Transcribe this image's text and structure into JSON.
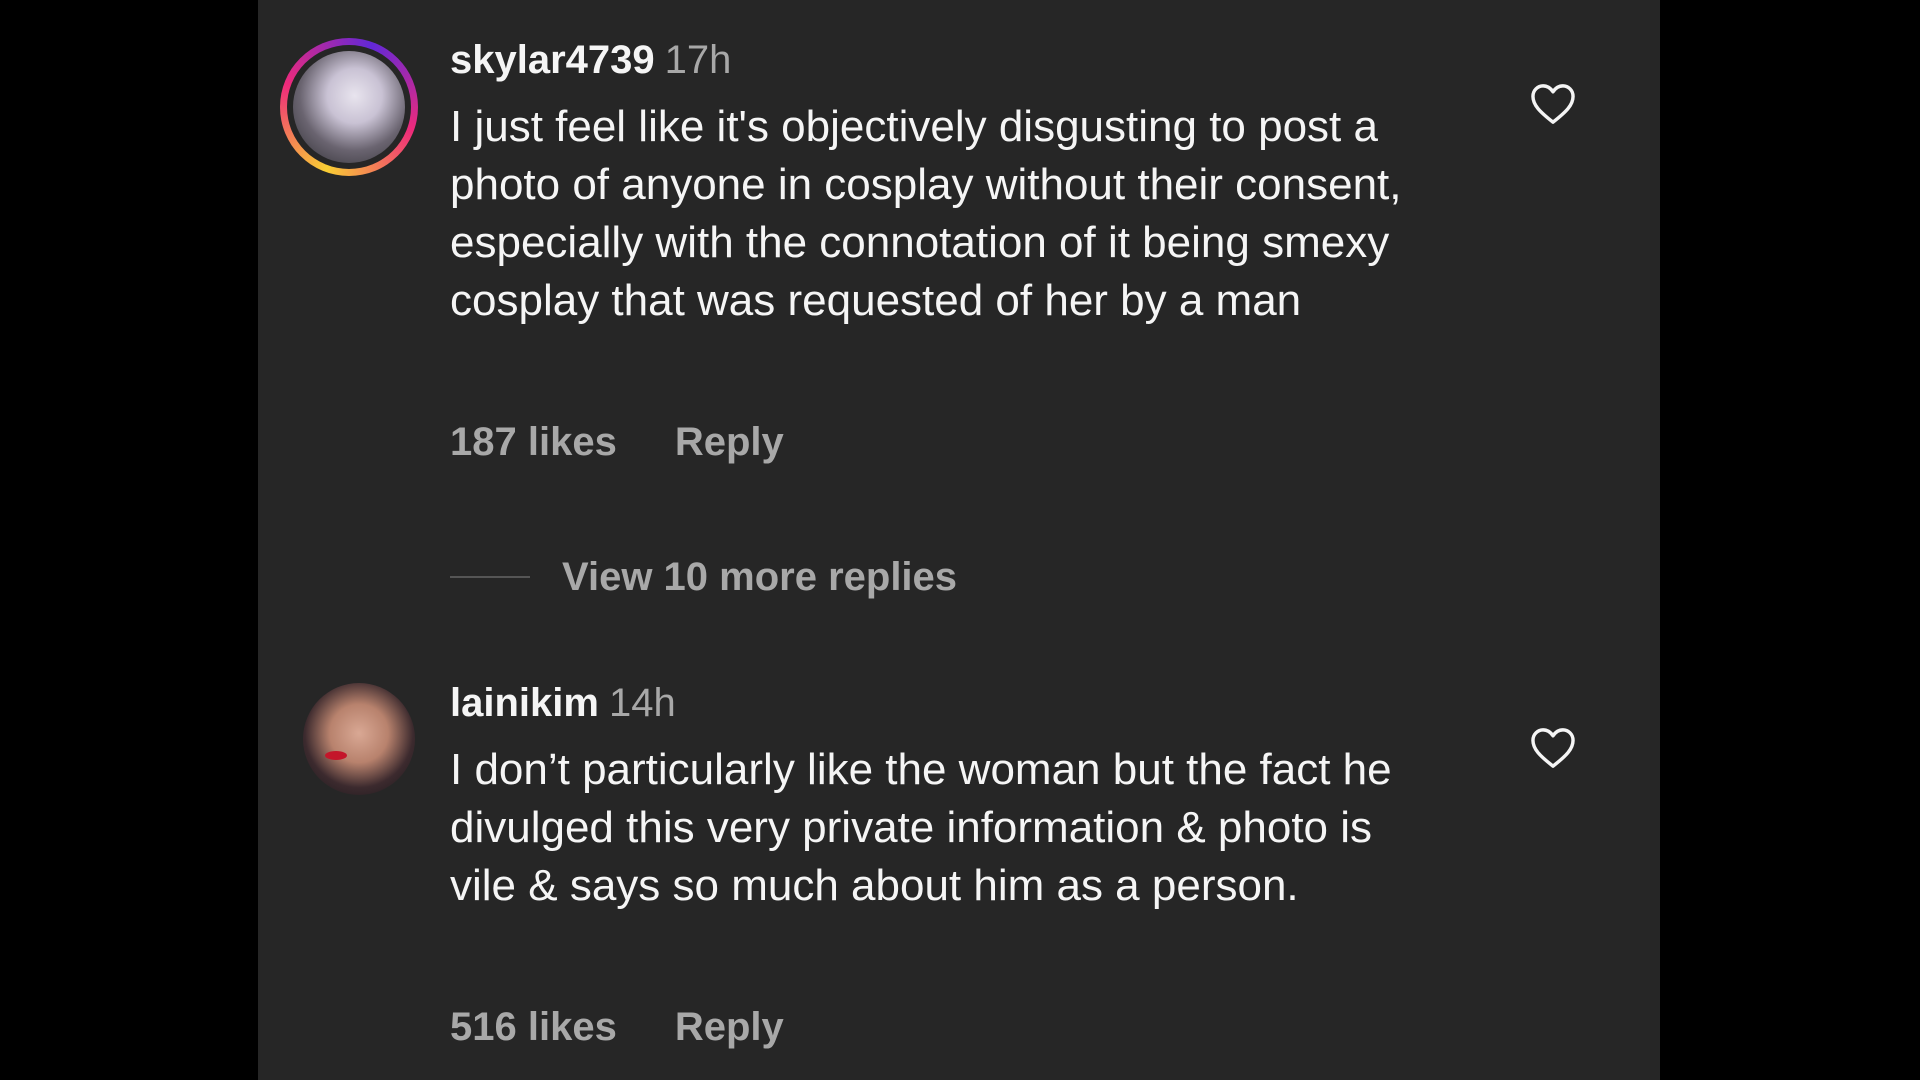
{
  "comments": [
    {
      "username": "skylar4739",
      "time": "17h",
      "text": "I just feel like it's objectively disgusting to post a photo of anyone in cosplay without their consent, especially with the connotation of it being smexy cosplay that was requested of her by a man",
      "likes": "187 likes",
      "reply_label": "Reply",
      "avatar_icon": "user-avatar-with-story-ring",
      "liked": false
    },
    {
      "username": "lainikim",
      "time": "14h",
      "text": "I don’t particularly like the woman but the fact he divulged this very private information & photo is vile & says so much about him as a person.",
      "likes": "516 likes",
      "reply_label": "Reply",
      "avatar_icon": "user-avatar",
      "liked": false
    }
  ],
  "view_replies": "View 10 more replies",
  "colors": {
    "background": "#000000",
    "panel": "#262626",
    "primary_text": "#f5f5f5",
    "secondary_text": "#a8a8a8"
  }
}
